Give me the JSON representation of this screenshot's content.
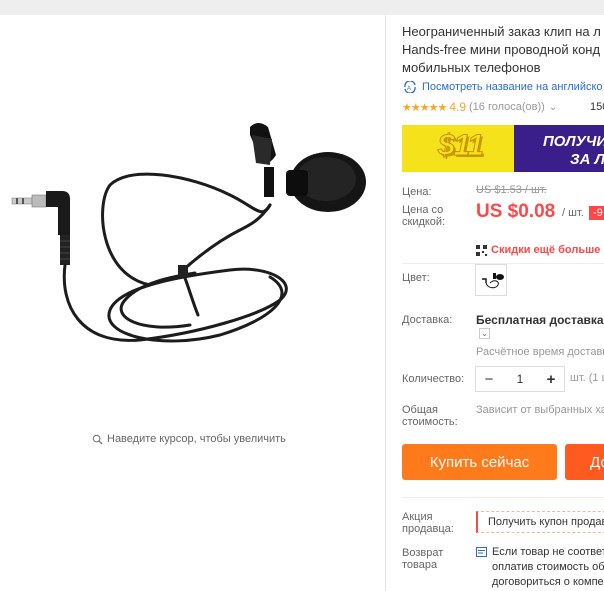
{
  "product": {
    "title_lines": [
      "Неограниченный заказ клип на л",
      "Hands-free мини проводной конд",
      "мобильных телефонов"
    ],
    "translate_link": "Посмотреть название на английско",
    "rating": "4.9",
    "stars": "★★★★★",
    "votes": "(16 голоса(ов))",
    "votes_chevron": "⌄",
    "orders": "150"
  },
  "gallery": {
    "zoom_hint": "Наведите курсор, чтобы увеличить"
  },
  "banner": {
    "amount": "$11",
    "line1": "ПОЛУЧИ",
    "line2": "ЗА Л"
  },
  "price": {
    "label": "Цена:",
    "old": "US $1.53 / шт.",
    "discount_label_1": "Цена со",
    "discount_label_2": "скидкой:",
    "new": "US $0.08",
    "unit": "/ шт.",
    "badge": "-9",
    "app_discount": "Скидки ещё больше в п"
  },
  "options": {
    "color_label": "Цвет:",
    "shipping_label": "Доставка:",
    "shipping_title": "Бесплатная доставка в R",
    "shipping_chevron": "⌄",
    "shipping_est": "Расчётное время доставк",
    "quantity_label": "Количество:",
    "quantity_minus": "−",
    "quantity_value": "1",
    "quantity_plus": "+",
    "quantity_unit": "шт. (1 ш",
    "total_label_1": "Общая",
    "total_label_2": "стоимость:",
    "total_value": "Зависит от выбранных ха"
  },
  "actions": {
    "buy_now": "Купить сейчас",
    "add_to_cart": "До"
  },
  "seller": {
    "promo_label_1": "Акция",
    "promo_label_2": "продавца:",
    "coupon": "Получить купон продав",
    "return_label_1": "Возврат",
    "return_label_2": "товара",
    "return_lines": [
      "Если товар не соответс",
      "оплатив стоимость об",
      "договориться о компе"
    ]
  },
  "colors": {
    "accent": "#ff4747",
    "orange": "#ff7a1a",
    "link": "#2e6bd1",
    "star": "#f5a623"
  }
}
